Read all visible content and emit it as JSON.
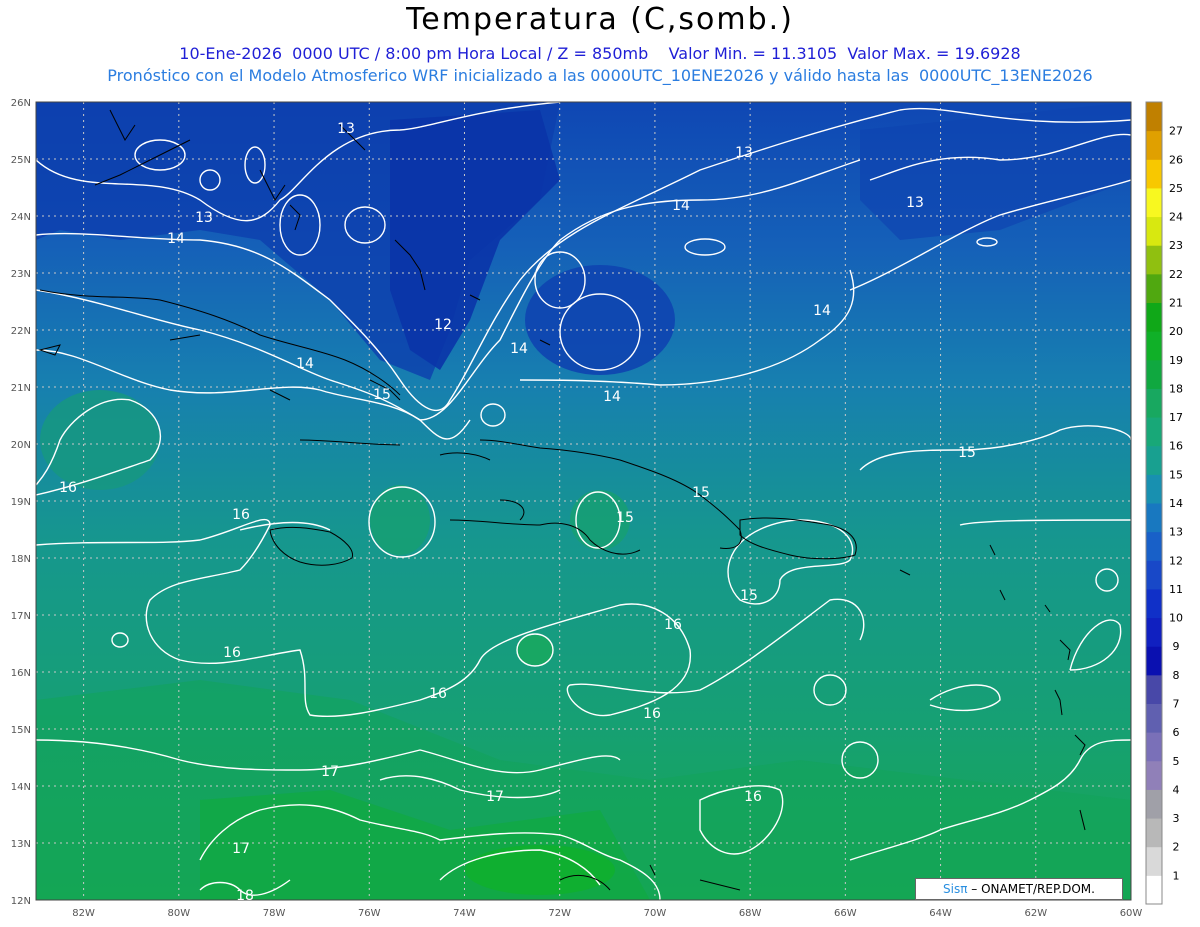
{
  "header": {
    "title": "Temperatura (C,somb.)",
    "subtitle_line1": "10-Ene-2026  0000 UTC / 8:00 pm Hora Local / Z = 850mb    Valor Min. = 11.3105  Valor Max. = 19.6928",
    "subtitle_line2": "Pronóstico con el Modelo Atmosferico WRF inicializado a las 0000UTC_10ENE2026 y válido hasta las  0000UTC_13ENE2026"
  },
  "map": {
    "lat_labels": [
      "26N",
      "25N",
      "24N",
      "23N",
      "22N",
      "21N",
      "20N",
      "19N",
      "18N",
      "17N",
      "16N",
      "15N",
      "14N",
      "13N",
      "12N"
    ],
    "lon_labels": [
      "82W",
      "80W",
      "78W",
      "76W",
      "74W",
      "72W",
      "70W",
      "68W",
      "66W",
      "64W",
      "62W",
      "60W"
    ],
    "contour_labels": [
      "13",
      "13",
      "13",
      "13",
      "14",
      "14",
      "14",
      "14",
      "14",
      "14",
      "12",
      "15",
      "15",
      "15",
      "15",
      "15",
      "16",
      "16",
      "16",
      "16",
      "16",
      "16",
      "16",
      "17",
      "17",
      "17",
      "18"
    ]
  },
  "colorbar": {
    "labels": [
      "1",
      "2",
      "3",
      "4",
      "5",
      "6",
      "7",
      "8",
      "9",
      "10",
      "11",
      "12",
      "13",
      "14",
      "15",
      "16",
      "17",
      "18",
      "19",
      "20",
      "21",
      "22",
      "23",
      "24",
      "25",
      "26",
      "27"
    ],
    "colors": [
      "#ffffff",
      "#d9d9d9",
      "#b8b8b8",
      "#a0a0a8",
      "#9080b8",
      "#7a70b8",
      "#6060b0",
      "#4848a8",
      "#0a10b0",
      "#1020c0",
      "#1030c8",
      "#1848c8",
      "#1860c8",
      "#1878c0",
      "#1890b0",
      "#18a090",
      "#18a878",
      "#18a860",
      "#10a840",
      "#10b028",
      "#10a818",
      "#50a810",
      "#90c010",
      "#d8e810",
      "#f8f820",
      "#f8c800",
      "#e0a000",
      "#c08000"
    ]
  },
  "credit": {
    "brand": "Sisπ",
    "text": " – ONAMET/REP.DOM."
  }
}
